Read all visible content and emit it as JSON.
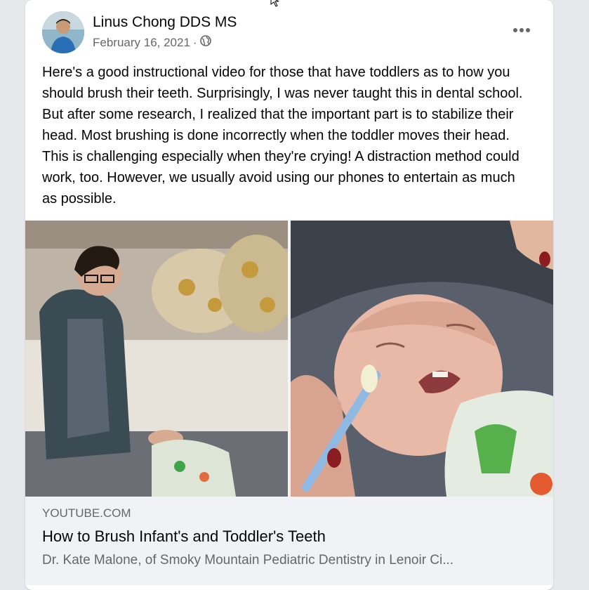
{
  "post": {
    "author": "Linus Chong DDS MS",
    "date": "February 16, 2021",
    "separator": "·",
    "audience_icon": "globe-icon",
    "more_icon": "more-options-icon",
    "body": "Here's a good instructional video for those that have toddlers as to how you should brush their teeth. Surprisingly, I was never taught this in dental school. But after some research, I realized that the important part is to stabilize their head. Most brushing is done incorrectly when the toddler moves their head. This is challenging especially when they're crying! A distraction method could work, too. However, we usually avoid using our phones to entertain as much as possible."
  },
  "link_preview": {
    "domain": "YOUTUBE.COM",
    "title": "How to Brush Infant's and Toddler's Teeth",
    "description": "Dr. Kate Malone, of Smoky Mountain Pediatric Dentistry in Lenoir Ci..."
  },
  "colors": {
    "primary_text": "#050505",
    "secondary_text": "#65676b",
    "card_bg": "#ffffff",
    "link_bg": "#f0f2f5"
  }
}
